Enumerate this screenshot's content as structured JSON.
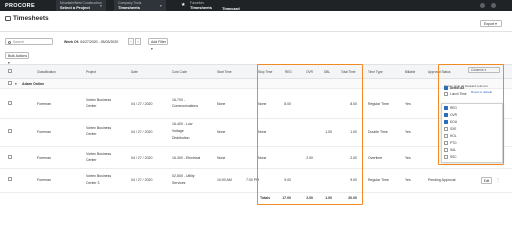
{
  "topbar": {
    "logo": "PROCORE",
    "company_small": "MountainWest Construction",
    "company_big": "Select a Project",
    "tools_small": "Company Tools",
    "tools_big": "Timesheets",
    "fav_small": "Favorites",
    "fav_big": "Timesheets",
    "fav_extra": "Timecard"
  },
  "header": {
    "title": "Timesheets",
    "export": "Export"
  },
  "filters": {
    "search_placeholder": "Search",
    "week_label": "Week Of:",
    "week_value": "04/27/2020 - 05/03/2020",
    "add_filter": "Add Filter",
    "bulk_actions": "Bulk Actions"
  },
  "table": {
    "columns": [
      "Classification",
      "Project",
      "Date",
      "Cost Code",
      "Start Time",
      "Stop Time",
      "REG",
      "OVR",
      "DBL",
      "Total Time",
      "Time Type",
      "Billable",
      "Approval Status"
    ],
    "group": "Adam Online",
    "rows": [
      {
        "classification": "Foreman",
        "project1": "Vortex Business",
        "project2": "Center",
        "date": "04 / 27 / 2020",
        "cost1": "16-700 -",
        "cost2": "Communications",
        "cost3": "",
        "start": "None",
        "stop": "None",
        "reg": "8.00",
        "ovr": "",
        "dbl": "",
        "total": "8.00",
        "type": "Regular Time",
        "billable": "Yes",
        "status": "Pending Approval"
      },
      {
        "classification": "Foreman",
        "project1": "Vortex Business",
        "project2": "Center",
        "date": "04 / 27 / 2020",
        "cost1": "16-400 - Low",
        "cost2": "Voltage",
        "cost3": "Distribution",
        "start": "None",
        "stop": "None",
        "reg": "",
        "ovr": "",
        "dbl": "1.00",
        "total": "1.00",
        "type": "Double Time",
        "billable": "Yes",
        "status": "Pending Approval"
      },
      {
        "classification": "Foreman",
        "project1": "Vortex Business",
        "project2": "Center",
        "date": "04 / 27 / 2020",
        "cost1": "16-300 - Electrical",
        "cost2": "",
        "cost3": "",
        "start": "None",
        "stop": "None",
        "reg": "",
        "ovr": "2.00",
        "dbl": "",
        "total": "2.00",
        "type": "Overtime",
        "billable": "Yes",
        "status": "Pending Approval"
      },
      {
        "classification": "Foreman",
        "project1": "Vortex Business",
        "project2": "Center 3",
        "date": "04 / 27 / 2020",
        "cost1": "02-500 - Utility",
        "cost2": "Services",
        "cost3": "",
        "start": "10:00 AM",
        "stop": "7:00 PM",
        "reg": "9.00",
        "ovr": "",
        "dbl": "",
        "total": "9.00",
        "type": "Regular Time",
        "billable": "Yes",
        "status": "Pending Approval"
      }
    ],
    "totals": {
      "label": "Totals",
      "reg": "17.00",
      "ovr": "2.00",
      "dbl": "1.00",
      "total": "20.00"
    },
    "edit_label": "Edit"
  },
  "column_chooser": {
    "select_placeholder": "Columns",
    "title": "Show / Hide all Detailed columns",
    "reset": "Reset to default",
    "items": [
      {
        "label": "Select All",
        "checked": true,
        "bold": true
      },
      {
        "label": "Lunch Time",
        "checked": false
      },
      {
        "label": "REG",
        "checked": true
      },
      {
        "label": "OVR",
        "checked": true
      },
      {
        "label": "DOU",
        "checked": true
      },
      {
        "label": "SXE",
        "checked": false
      },
      {
        "label": "HOL",
        "checked": false
      },
      {
        "label": "PTO",
        "checked": false
      },
      {
        "label": "SAL",
        "checked": false
      },
      {
        "label": "SSC",
        "checked": false
      }
    ]
  },
  "colors": {
    "highlight": "#f08a24",
    "topbar": "#1f2326",
    "accent": "#2a6ebb"
  }
}
